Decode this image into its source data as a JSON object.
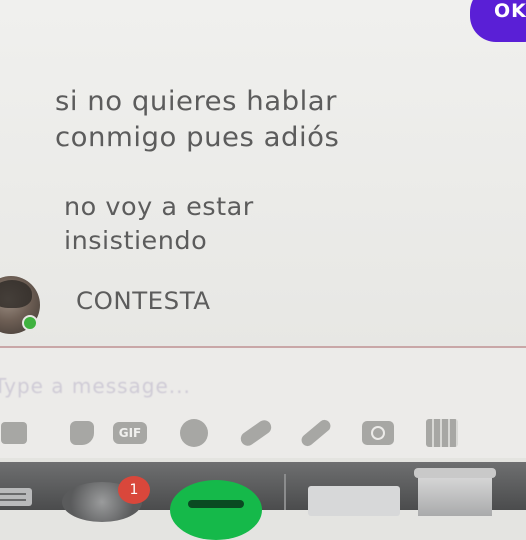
{
  "window": {
    "top_button_label": "OK"
  },
  "chat": {
    "messages": [
      {
        "lines": [
          "si no quieres hablar",
          "conmigo pues adiós"
        ]
      },
      {
        "lines": [
          "no voy a estar",
          "insistiendo"
        ]
      },
      {
        "lines": [
          "CONTESTA"
        ]
      }
    ],
    "presence_color": "#3fb23f"
  },
  "composer": {
    "placeholder": "Type a message...",
    "tools": [
      "image-icon",
      "sticker-icon",
      "gif-icon",
      "emoji-icon",
      "link-icon",
      "attachment-icon",
      "camera-icon",
      "calendar-icon"
    ],
    "gif_label": "GIF"
  },
  "dock": {
    "badge_count": "1",
    "items": [
      "menu-icon",
      "settings-icon",
      "spotify-icon",
      "window-thumbnail",
      "trash-icon"
    ]
  },
  "colors": {
    "accent": "#5a1fd6",
    "badge": "#d9473b",
    "spotify": "#15b94a"
  }
}
